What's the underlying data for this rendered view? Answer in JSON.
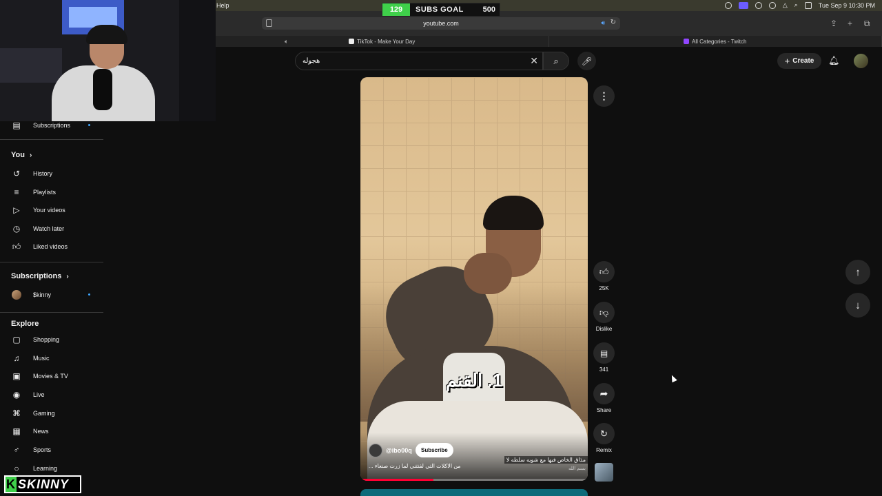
{
  "menubar": {
    "help": "Help",
    "datetime": "Tue Sep 9  10:30 PM"
  },
  "subs_goal": {
    "current": "129",
    "label": "SUBS GOAL",
    "target": "500"
  },
  "browser": {
    "url": "youtube.com",
    "tabs": [
      {
        "label": "TikTok - Make Your Day"
      },
      {
        "label": "All Categories - Twitch"
      }
    ]
  },
  "search": {
    "value": "هجوله"
  },
  "header": {
    "create_label": "Create"
  },
  "sidebar": {
    "subscriptions_top": "Subscriptions",
    "you_heading": "You",
    "you_items": [
      "History",
      "Playlists",
      "Your videos",
      "Watch later",
      "Liked videos"
    ],
    "subscriptions_heading": "Subscriptions",
    "subscription_channels": [
      "$kinny"
    ],
    "explore_heading": "Explore",
    "explore_items": [
      "Shopping",
      "Music",
      "Movies & TV",
      "Live",
      "Gaming",
      "News",
      "Sports",
      "Learning"
    ]
  },
  "brand": {
    "letter": "K",
    "text": "SKINNY"
  },
  "video": {
    "caption": "1. القنم",
    "channel": "@ibo00q",
    "subscribe_label": "Subscribe",
    "description": "من الاكلات التي لفتتني لما زرت صنعاء ...",
    "annotation": "مذاق الخاص فيها مع شويه سلطه لا",
    "annotation_sub": "بسم الله",
    "progress": 0.32
  },
  "actions": {
    "likes": "25K",
    "dislike": "Dislike",
    "comments": "341",
    "share": "Share",
    "remix": "Remix"
  },
  "colors": {
    "accent": "#3ea6ff",
    "brand_green": "#3fd04a",
    "progress_red": "#ff0033"
  }
}
